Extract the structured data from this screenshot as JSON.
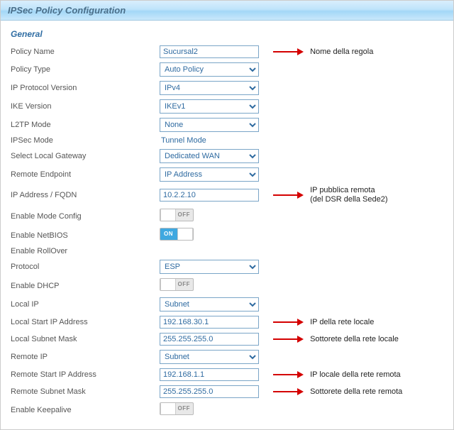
{
  "header": {
    "title": "IPSec Policy Configuration"
  },
  "section": {
    "general": "General"
  },
  "labels": {
    "policy_name": "Policy Name",
    "policy_type": "Policy Type",
    "ip_proto_ver": "IP Protocol Version",
    "ike_ver": "IKE Version",
    "l2tp_mode": "L2TP Mode",
    "ipsec_mode": "IPSec Mode",
    "local_gw": "Select Local Gateway",
    "remote_ep": "Remote Endpoint",
    "ip_fqdn": "IP Address / FQDN",
    "mode_config": "Enable Mode Config",
    "netbios": "Enable NetBIOS",
    "rollover": "Enable RollOver",
    "protocol": "Protocol",
    "dhcp": "Enable DHCP",
    "local_ip": "Local IP",
    "local_start": "Local Start IP Address",
    "local_mask": "Local Subnet Mask",
    "remote_ip": "Remote IP",
    "remote_start": "Remote Start IP Address",
    "remote_mask": "Remote Subnet Mask",
    "keepalive": "Enable Keepalive"
  },
  "values": {
    "policy_name": "Sucursal2",
    "policy_type": "Auto Policy",
    "ip_proto_ver": "IPv4",
    "ike_ver": "IKEv1",
    "l2tp_mode": "None",
    "ipsec_mode": "Tunnel Mode",
    "local_gw": "Dedicated WAN",
    "remote_ep": "IP Address",
    "ip_fqdn": "10.2.2.10",
    "protocol": "ESP",
    "local_ip": "Subnet",
    "local_start": "192.168.30.1",
    "local_mask": "255.255.255.0",
    "remote_ip": "Subnet",
    "remote_start": "192.168.1.1",
    "remote_mask": "255.255.255.0"
  },
  "toggles": {
    "mode_config": "OFF",
    "netbios": "ON",
    "dhcp": "OFF",
    "keepalive": "OFF"
  },
  "annotations": {
    "policy_name": "Nome della regola",
    "ip_fqdn_l1": "IP pubblica remota",
    "ip_fqdn_l2": "(del DSR della Sede2)",
    "local_start": "IP della rete locale",
    "local_mask": "Sottorete della rete locale",
    "remote_start": "IP locale della rete remota",
    "remote_mask": "Sottorete della rete remota"
  }
}
